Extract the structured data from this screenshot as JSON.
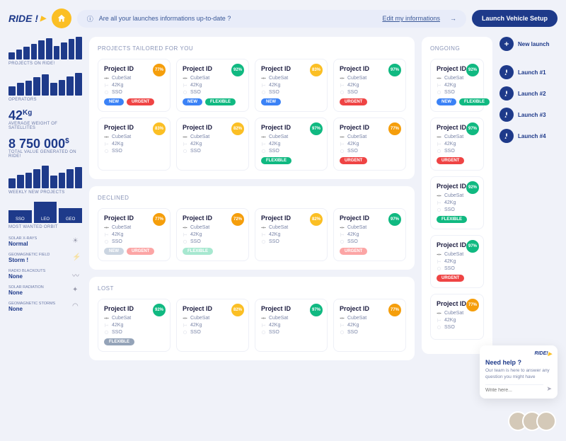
{
  "header": {
    "logo": "RIDE !",
    "banner_question": "Are all your launches informations up-to-date ?",
    "banner_link": "Edit my informations",
    "cta": "Launch Vehicle Setup"
  },
  "sidebar": {
    "projects_label": "PROJECTS ON RIDE!",
    "operators_label": "OPERATORS",
    "avg_weight": "42",
    "avg_weight_unit": "Kg",
    "avg_weight_label": "AVERAGE WEIGHT OF SATELLITES",
    "total_value": "8 750 000",
    "total_value_unit": "$",
    "total_value_label": "TOTAL VALUE GENERATED ON RIDE!",
    "weekly_label": "WEEKLY NEW PROJECTS",
    "orbit_label": "MOST WANTED ORBIT",
    "orbits": [
      "SSO",
      "LEO",
      "GEO"
    ],
    "weather": [
      {
        "label": "SOLAR X-RAYS",
        "value": "Normal"
      },
      {
        "label": "GEOMAGNETIC FIELD",
        "value": "Storm !"
      },
      {
        "label": "RADIO BLACKOUTS",
        "value": "None"
      },
      {
        "label": "SOLAR RADIATION",
        "value": "None"
      },
      {
        "label": "GEOMAGNETIC STORMS",
        "value": "None"
      }
    ]
  },
  "common": {
    "project_id": "Project ID",
    "type": "CubeSat",
    "weight": "42Kg",
    "orbit": "SSO",
    "tag_new": "NEW",
    "tag_urgent": "URGENT",
    "tag_flexible": "FLEXIBLE"
  },
  "sections": {
    "tailored": {
      "title": "PROJECTS TAILORED FOR YOU",
      "cards": [
        {
          "pct": "77%",
          "color": "bg-orange",
          "tags": [
            "new",
            "urgent"
          ]
        },
        {
          "pct": "92%",
          "color": "bg-green",
          "tags": [
            "new",
            "flexible"
          ]
        },
        {
          "pct": "83%",
          "color": "bg-yellow",
          "tags": [
            "new"
          ]
        },
        {
          "pct": "97%",
          "color": "bg-green",
          "tags": [
            "urgent"
          ]
        },
        {
          "pct": "83%",
          "color": "bg-yellow",
          "tags": []
        },
        {
          "pct": "82%",
          "color": "bg-yellow",
          "tags": []
        },
        {
          "pct": "97%",
          "color": "bg-green",
          "tags": [
            "flexible"
          ]
        },
        {
          "pct": "77%",
          "color": "bg-orange",
          "tags": [
            "urgent"
          ]
        }
      ]
    },
    "declined": {
      "title": "DECLINED",
      "cards": [
        {
          "pct": "77%",
          "color": "bg-orange",
          "tags": [
            "new-m",
            "urgent-m"
          ]
        },
        {
          "pct": "72%",
          "color": "bg-orange",
          "tags": [
            "flexible-m"
          ]
        },
        {
          "pct": "82%",
          "color": "bg-yellow",
          "tags": []
        },
        {
          "pct": "97%",
          "color": "bg-green",
          "tags": [
            "urgent-m"
          ]
        }
      ]
    },
    "lost": {
      "title": "LOST",
      "cards": [
        {
          "pct": "92%",
          "color": "bg-green",
          "tags": [
            "grey"
          ]
        },
        {
          "pct": "82%",
          "color": "bg-yellow",
          "tags": []
        },
        {
          "pct": "97%",
          "color": "bg-green",
          "tags": []
        },
        {
          "pct": "77%",
          "color": "bg-orange",
          "tags": []
        }
      ]
    },
    "ongoing": {
      "title": "ONGOING",
      "cards": [
        {
          "pct": "92%",
          "color": "bg-green",
          "tags": [
            "new",
            "flexible"
          ]
        },
        {
          "pct": "97%",
          "color": "bg-green",
          "tags": [
            "urgent"
          ]
        },
        {
          "pct": "92%",
          "color": "bg-green",
          "tags": [
            "flexible"
          ]
        },
        {
          "pct": "97%",
          "color": "bg-green",
          "tags": [
            "urgent"
          ]
        },
        {
          "pct": "77%",
          "color": "bg-orange",
          "tags": []
        }
      ]
    }
  },
  "actions": {
    "new_launch": "New launch",
    "items": [
      "Launch #1",
      "Launch #2",
      "Launch #3",
      "Launch #4"
    ]
  },
  "help": {
    "logo": "RIDE!",
    "title": "Need help ?",
    "text": "Our team is here to answer any question you might have",
    "placeholder": "Write here..."
  },
  "chart_data": [
    {
      "type": "bar",
      "title": "PROJECTS ON RIDE!",
      "values": [
        30,
        45,
        55,
        70,
        85,
        95,
        60,
        75,
        90,
        100
      ],
      "ylim": [
        0,
        100
      ]
    },
    {
      "type": "bar",
      "title": "OPERATORS",
      "values": [
        40,
        55,
        65,
        80,
        95,
        55,
        70,
        85,
        100
      ],
      "ylim": [
        0,
        100
      ]
    },
    {
      "type": "bar",
      "title": "WEEKLY NEW PROJECTS",
      "values": [
        45,
        60,
        70,
        85,
        100,
        55,
        70,
        85,
        95
      ],
      "ylim": [
        0,
        100
      ]
    },
    {
      "type": "bar",
      "title": "MOST WANTED ORBIT",
      "categories": [
        "SSO",
        "LEO",
        "GEO"
      ],
      "values": [
        60,
        100,
        70
      ],
      "ylim": [
        0,
        100
      ]
    }
  ]
}
